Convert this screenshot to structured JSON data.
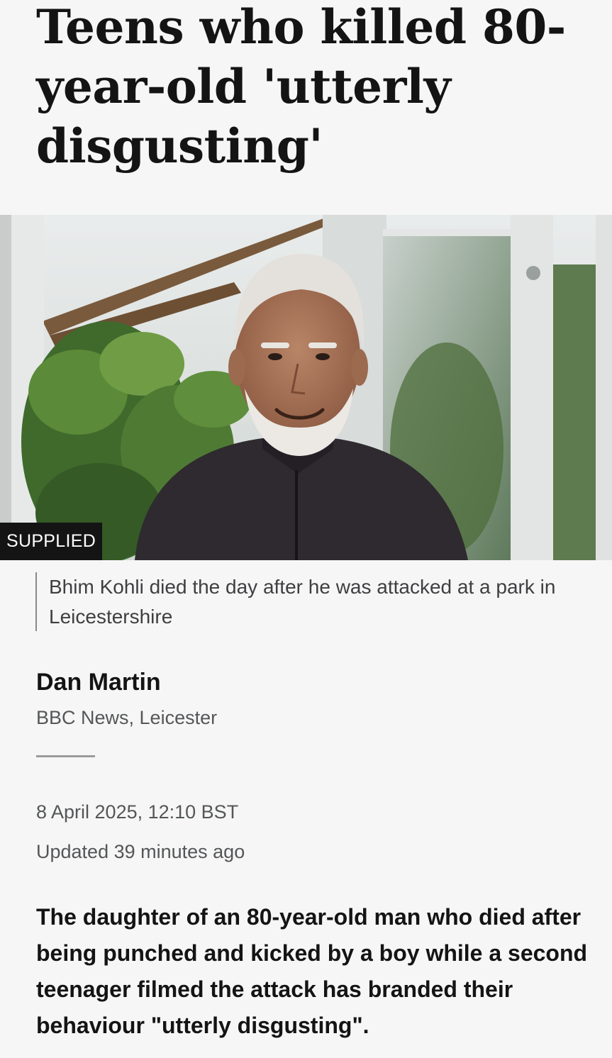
{
  "article": {
    "headline": "Teens who killed 80-year-old 'utterly disgusting'",
    "image": {
      "subject": "Photo of an elderly man with white hair and beard smiling in a greenhouse",
      "credit": "SUPPLIED",
      "caption": "Bhim Kohli died the day after he was attacked at a park in Leicestershire"
    },
    "byline": {
      "author": "Dan Martin",
      "role": "BBC News, Leicester"
    },
    "date": "8 April 2025, 12:10 BST",
    "updated": "Updated 39 minutes ago",
    "lede": "The daughter of an 80-year-old man who died after being punched and kicked by a boy while a second teenager filmed the attack has branded their behaviour \"utterly disgusting\"."
  },
  "colors": {
    "background": "#f6f6f6",
    "text_primary": "#141414",
    "text_secondary": "#545658",
    "credit_background": "#141414"
  }
}
